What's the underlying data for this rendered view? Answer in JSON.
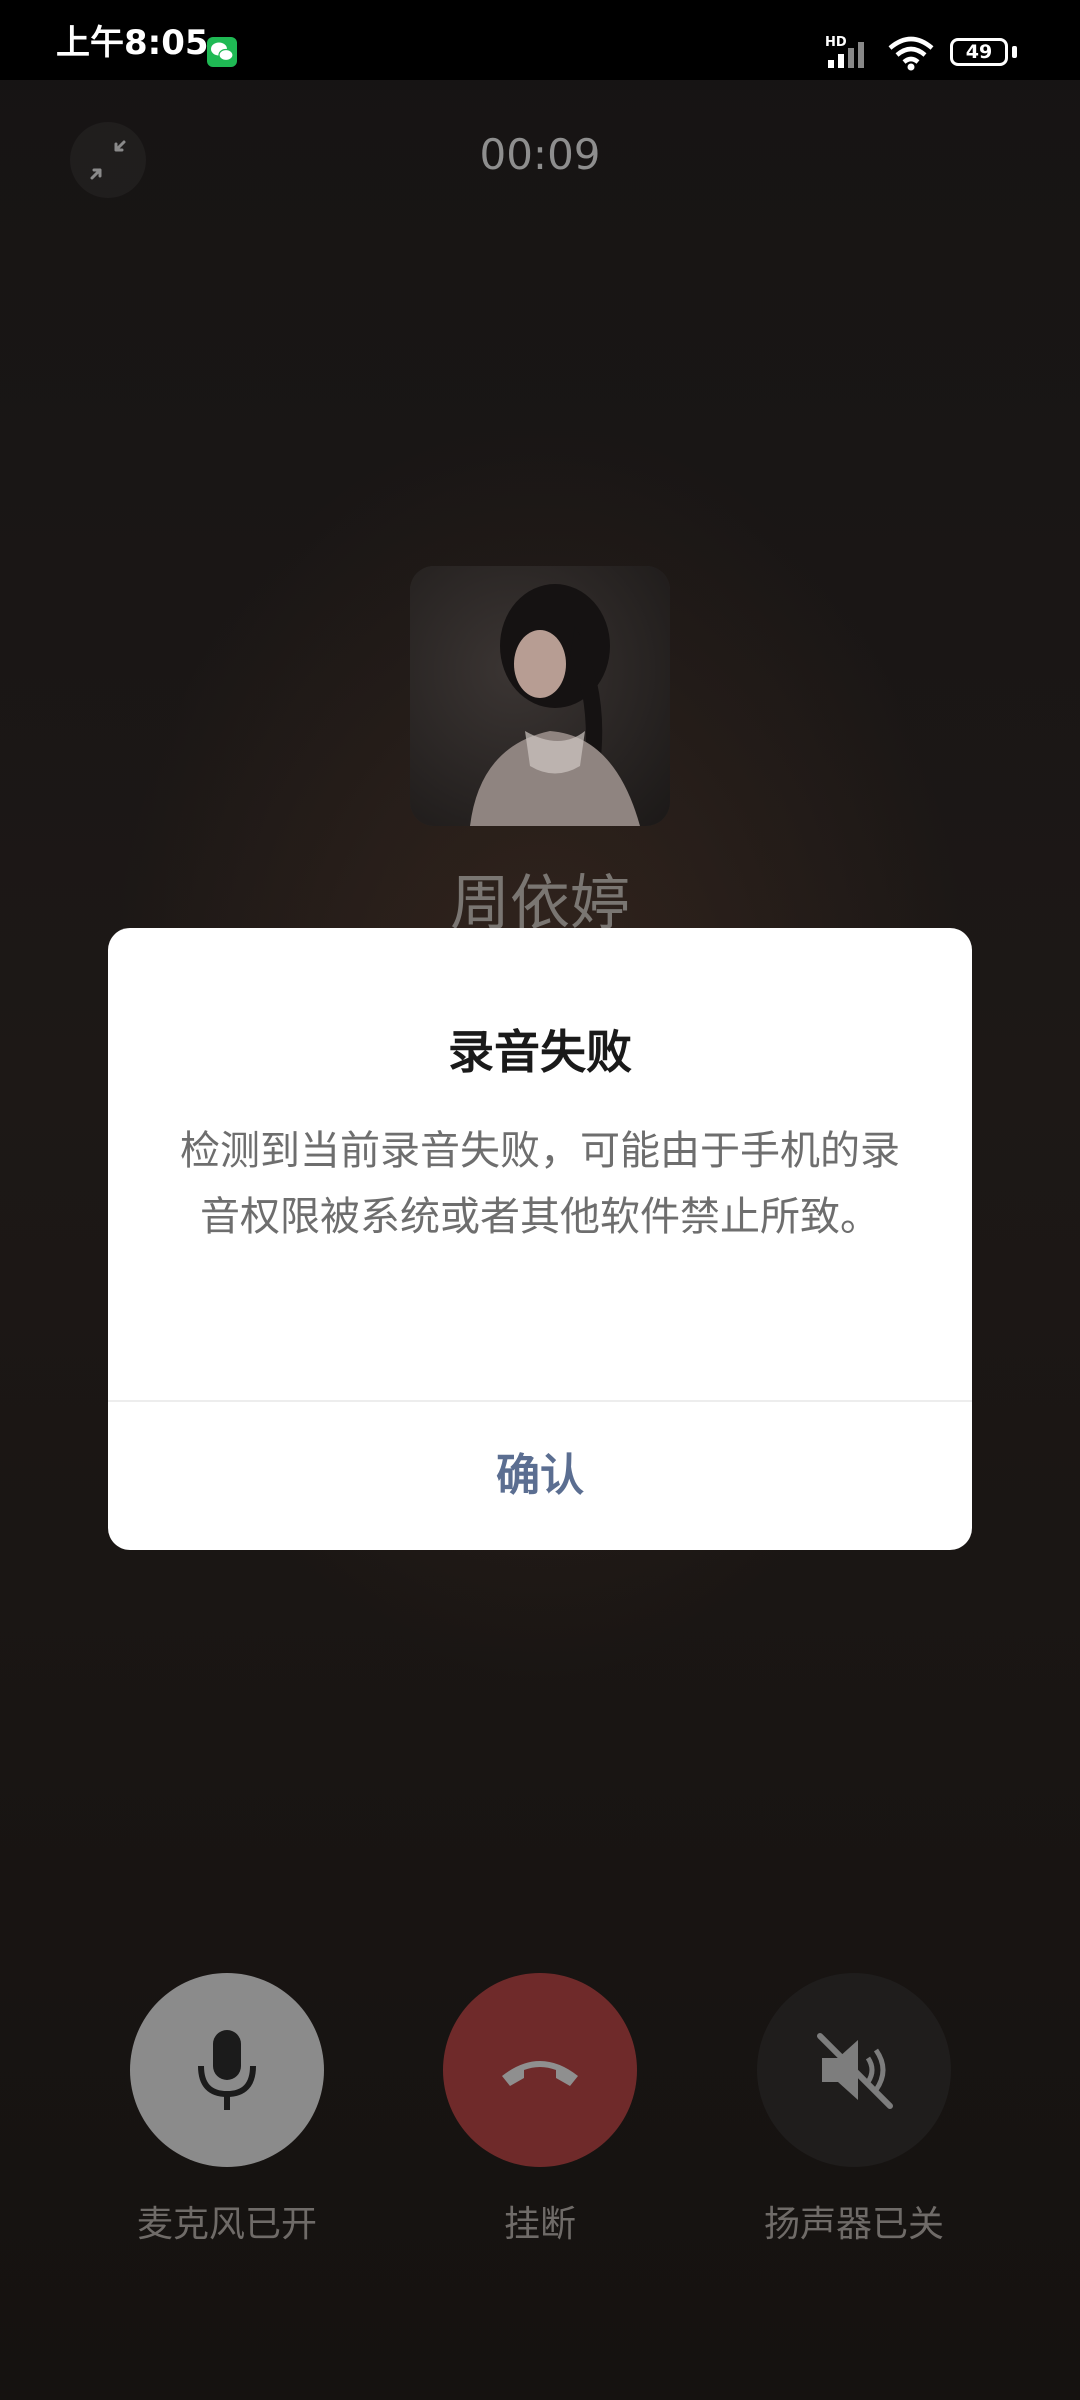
{
  "status_bar": {
    "time": "上午8:05",
    "network_label": "HD",
    "battery": "49",
    "icons": [
      "wechat-icon",
      "signal-icon",
      "wifi-icon",
      "battery-icon"
    ]
  },
  "call": {
    "timer": "00:09",
    "contact_name": "周依婷",
    "minimize_icon": "minimize-arrows-icon"
  },
  "dialog": {
    "title": "录音失败",
    "message": "检测到当前录音失败，可能由于手机的录音权限被系统或者其他软件禁止所致。",
    "confirm_label": "确认",
    "confirm_color": "#5b6e91"
  },
  "controls": {
    "mic_label": "麦克风已开",
    "hangup_label": "挂断",
    "speaker_label": "扬声器已关",
    "hangup_color": "#6f2a2a"
  }
}
